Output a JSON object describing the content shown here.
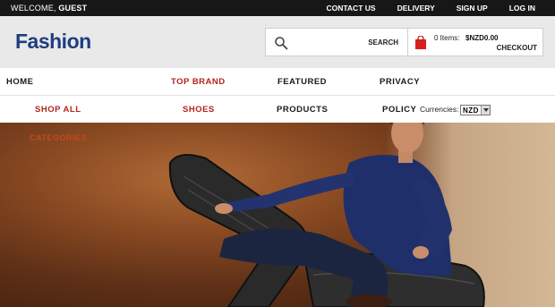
{
  "topbar": {
    "welcome_label": "WELCOME,",
    "welcome_user": "GUEST",
    "links": [
      "CONTACT US",
      "DELIVERY",
      "SIGN UP",
      "LOG IN"
    ]
  },
  "header": {
    "logo": "Fashion",
    "search": {
      "button_label": "SEARCH",
      "icon": "search-icon"
    },
    "cart": {
      "icon": "shopping-bag-icon",
      "items_label": "0 Items:",
      "total": "$NZD0.00",
      "checkout_label": "CHECKOUT"
    }
  },
  "nav_primary": [
    "HOME",
    "TOP BRAND",
    "FEATURED",
    "PRIVACY"
  ],
  "nav_secondary": [
    "SHOP ALL",
    "SHOES",
    "PRODUCTS",
    "POLICY"
  ],
  "currency": {
    "label": "Currencies:",
    "selected": "NZD"
  },
  "hero": {
    "categories_label": "CATEGORIES"
  },
  "colors": {
    "accent_red": "#b3231b",
    "logo_blue": "#1f3d80",
    "topbar_bg": "#171717"
  }
}
